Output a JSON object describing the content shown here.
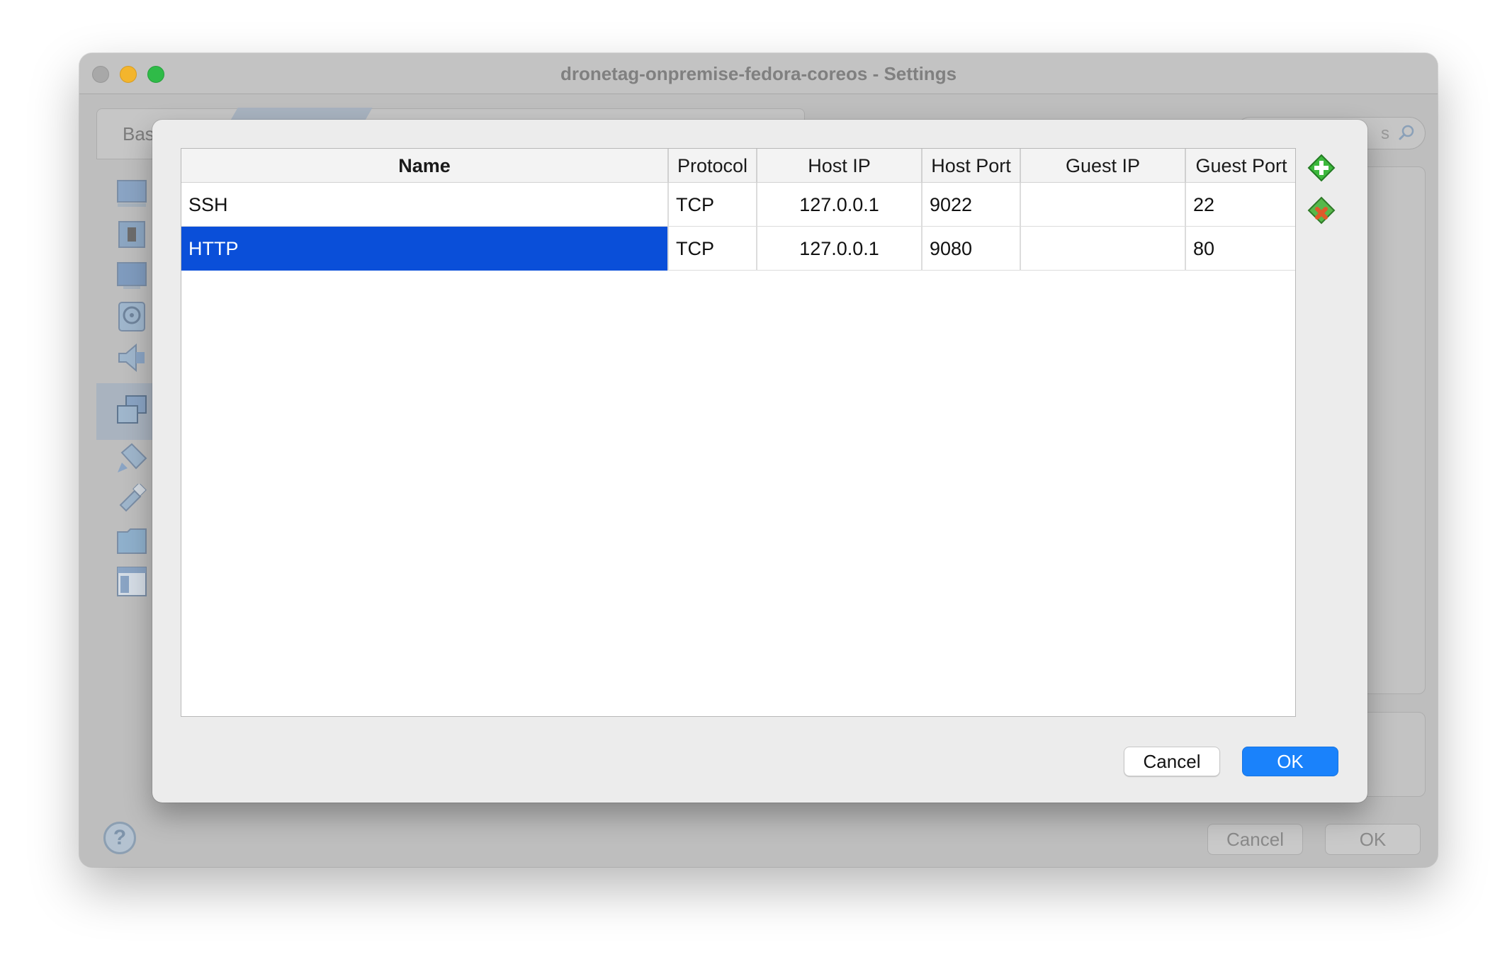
{
  "window": {
    "title": "dronetag-onpremise-fedora-coreos - Settings"
  },
  "mode_tabs": {
    "basic_label": "Bas"
  },
  "search": {
    "placeholder_fragment": "s"
  },
  "sidebar": {
    "items": [
      {
        "icon": "general-icon"
      },
      {
        "icon": "system-icon"
      },
      {
        "icon": "display-icon"
      },
      {
        "icon": "storage-icon"
      },
      {
        "icon": "audio-icon"
      },
      {
        "icon": "network-icon",
        "selected": true
      },
      {
        "icon": "serial-ports-icon"
      },
      {
        "icon": "usb-icon"
      },
      {
        "icon": "shared-folders-icon"
      },
      {
        "icon": "user-interface-icon"
      }
    ]
  },
  "port_forwarding": {
    "columns": [
      "Name",
      "Protocol",
      "Host IP",
      "Host Port",
      "Guest IP",
      "Guest Port"
    ],
    "rules": [
      {
        "name": "SSH",
        "protocol": "TCP",
        "host_ip": "127.0.0.1",
        "host_port": "9022",
        "guest_ip": "",
        "guest_port": "22",
        "selected": false
      },
      {
        "name": "HTTP",
        "protocol": "TCP",
        "host_ip": "127.0.0.1",
        "host_port": "9080",
        "guest_ip": "",
        "guest_port": "80",
        "selected": true
      }
    ],
    "cancel_label": "Cancel",
    "ok_label": "OK"
  },
  "footer": {
    "help_label": "?",
    "cancel_label": "Cancel",
    "ok_label": "OK"
  },
  "colors": {
    "selection": "#0a4fd9",
    "primary_button": "#1a82fb",
    "add_icon": "#3cb83c",
    "remove_icon": "#e05a2a"
  }
}
